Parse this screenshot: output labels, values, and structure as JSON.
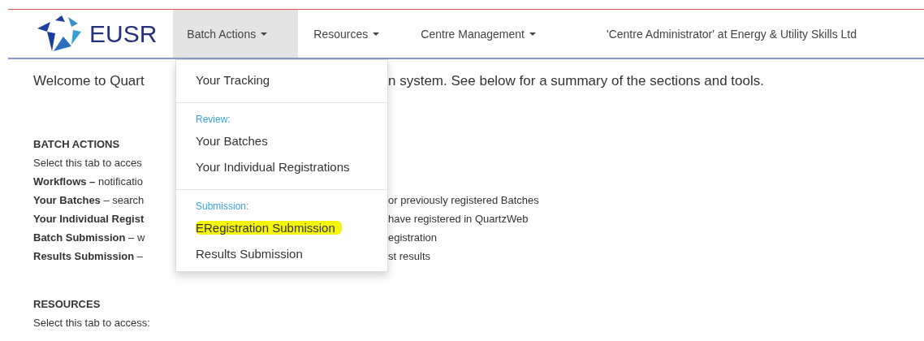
{
  "navbar": {
    "brand": "EUSR",
    "tabs": [
      {
        "label": "Batch Actions",
        "selected": true
      },
      {
        "label": "Resources",
        "selected": false
      },
      {
        "label": "Centre Management",
        "selected": false
      }
    ],
    "user": "'Centre Administrator' at Energy & Utility Skills Ltd"
  },
  "dropdown": [
    {
      "kind": "item",
      "label": "Your Tracking",
      "highlighted": false
    },
    {
      "kind": "divider"
    },
    {
      "kind": "header",
      "label": "Review:"
    },
    {
      "kind": "item",
      "label": "Your Batches",
      "highlighted": false
    },
    {
      "kind": "item",
      "label": "Your Individual Registrations",
      "highlighted": false
    },
    {
      "kind": "divider"
    },
    {
      "kind": "header",
      "label": "Submission:"
    },
    {
      "kind": "item",
      "label": "ERegistration Submission",
      "highlighted": true
    },
    {
      "kind": "item",
      "label": "Results Submission",
      "highlighted": false
    }
  ],
  "content": [
    {
      "kind": "intro",
      "left": "Welcome to Quart",
      "right": "n system. See below for a summary of the sections and tools."
    },
    {
      "kind": "heading",
      "left": "BATCH ACTIONS"
    },
    {
      "kind": "line",
      "left": "Select this tab to acces"
    },
    {
      "kind": "line",
      "left": "**Workflows –** notificatio"
    },
    {
      "kind": "line",
      "left": "**Your Batches** – search",
      "right": "or previously registered Batches"
    },
    {
      "kind": "line",
      "left": "**Your Individual Regist**",
      "right": "have registered in QuartzWeb"
    },
    {
      "kind": "line",
      "left": "**Batch Submission** – w",
      "right": "egistration"
    },
    {
      "kind": "line",
      "left": "**Results Submission** –",
      "right": "st results"
    },
    {
      "kind": "heading",
      "left": "RESOURCES"
    },
    {
      "kind": "line",
      "left": "Select this tab to access:"
    }
  ]
}
